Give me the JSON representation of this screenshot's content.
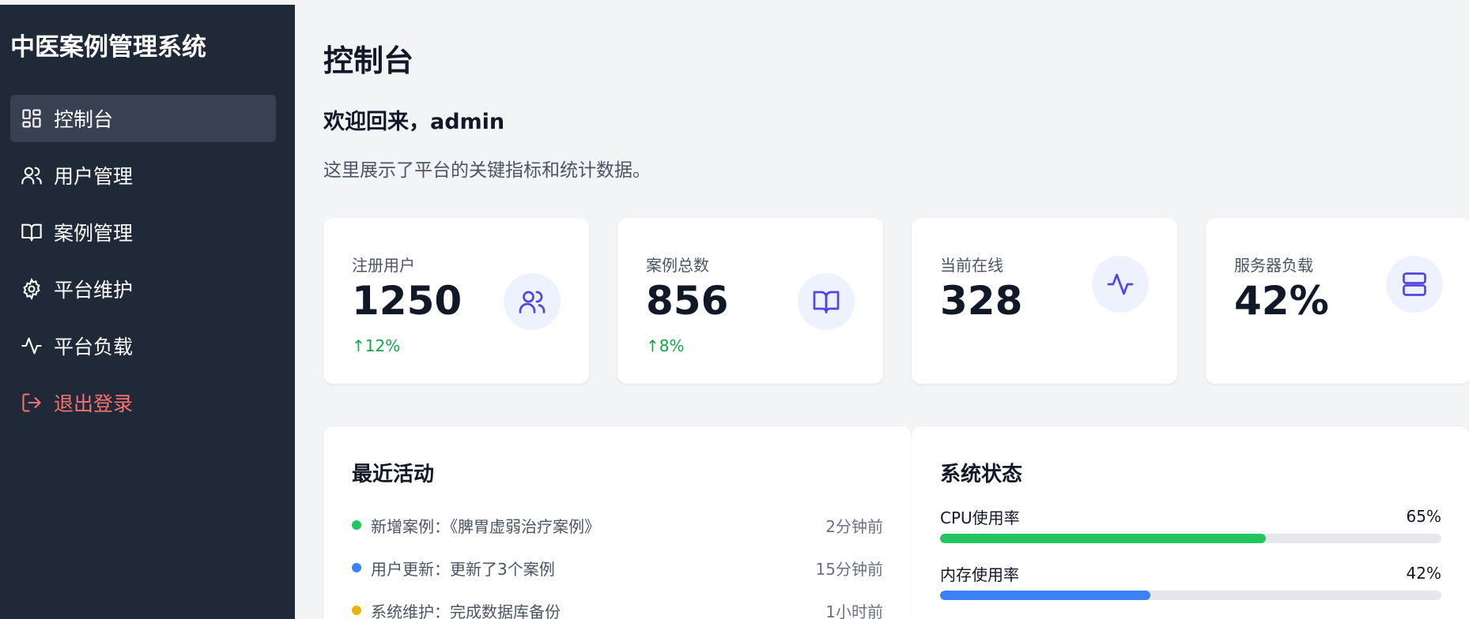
{
  "sidebar": {
    "brand": "中医案例管理系统",
    "items": [
      {
        "label": "控制台",
        "icon": "dashboard-icon",
        "active": true
      },
      {
        "label": "用户管理",
        "icon": "users-icon"
      },
      {
        "label": "案例管理",
        "icon": "book-icon"
      },
      {
        "label": "平台维护",
        "icon": "gear-icon"
      },
      {
        "label": "平台负载",
        "icon": "activity-icon"
      },
      {
        "label": "退出登录",
        "icon": "logout-icon"
      }
    ]
  },
  "header": {
    "title": "控制台",
    "welcome": "欢迎回来，admin",
    "description": "这里展示了平台的关键指标和统计数据。"
  },
  "stats": [
    {
      "label": "注册用户",
      "value": "1250",
      "trend": "↑12%",
      "icon": "users-icon"
    },
    {
      "label": "案例总数",
      "value": "856",
      "trend": "↑8%",
      "icon": "book-icon"
    },
    {
      "label": "当前在线",
      "value": "328",
      "icon": "activity-icon"
    },
    {
      "label": "服务器负载",
      "value": "42%",
      "icon": "server-icon"
    }
  ],
  "activity": {
    "title": "最近活动",
    "items": [
      {
        "text": "新增案例：《脾胃虚弱治疗案例》",
        "time": "2分钟前",
        "color": "#22c55e"
      },
      {
        "text": "用户更新：更新了3个案例",
        "time": "15分钟前",
        "color": "#3b82f6"
      },
      {
        "text": "系统维护：完成数据库备份",
        "time": "1小时前",
        "color": "#eab308"
      }
    ]
  },
  "system_status": {
    "title": "系统状态",
    "items": [
      {
        "label": "CPU使用率",
        "value": "65%",
        "percent": 65,
        "color": "#22c55e"
      },
      {
        "label": "内存使用率",
        "value": "42%",
        "percent": 42,
        "color": "#3b82f6"
      }
    ]
  },
  "colors": {
    "sidebar_bg": "#1f2937",
    "accent": "#4f46e5",
    "logout": "#f87171",
    "trend_up": "#16a34a"
  }
}
